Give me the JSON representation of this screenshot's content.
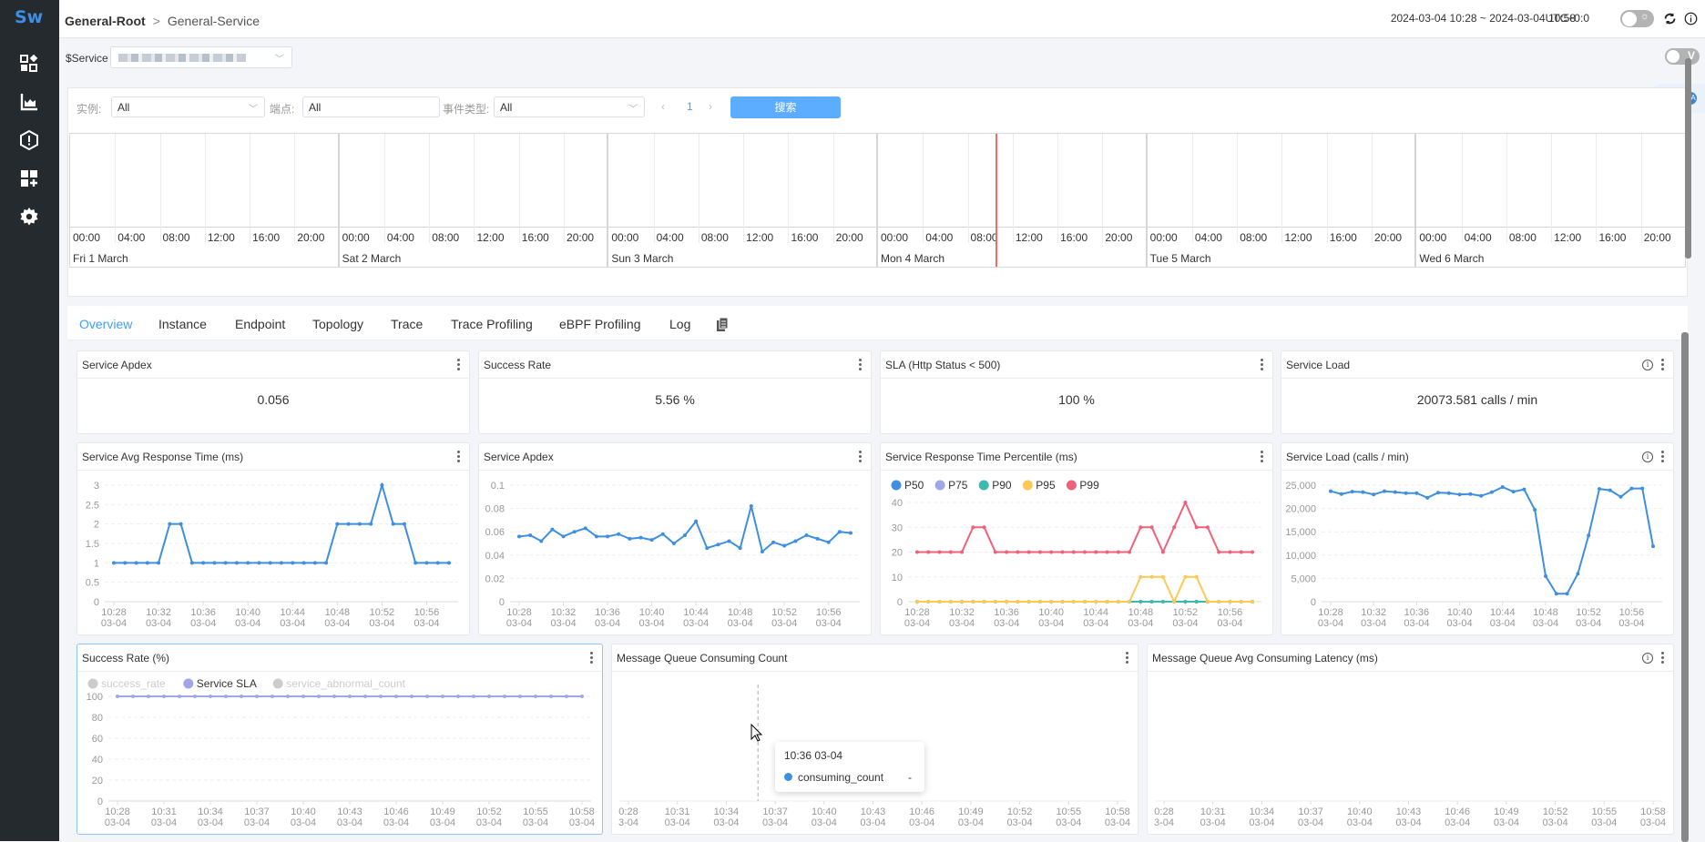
{
  "app": {
    "logo": "Sw"
  },
  "sidebar": {
    "items": [
      {
        "icon": "dashboard-icon"
      },
      {
        "icon": "metrics-chart-icon"
      },
      {
        "icon": "alert-icon"
      },
      {
        "icon": "add-widget-icon"
      },
      {
        "icon": "settings-icon"
      }
    ]
  },
  "header": {
    "breadcrumb": {
      "root": "General-Root",
      "current": "General-Service"
    },
    "time_range": "2024-03-04 10:28 ~ 2024-03-04 10:58",
    "timezone": "UTC+0:0",
    "theme_toggle": "off",
    "icons": [
      "refresh-icon",
      "info-icon"
    ]
  },
  "service_bar": {
    "label": "$Service",
    "value": "(blurred)",
    "v_toggle_label": "V"
  },
  "filters": {
    "instance_label": "实例:",
    "instance_value": "All",
    "endpoint_label": "端点:",
    "endpoint_value": "All",
    "event_type_label": "事件类型:",
    "event_type_value": "All",
    "page": "1",
    "search_button": "搜索"
  },
  "timeline": {
    "hours": [
      "00:00",
      "04:00",
      "08:00",
      "12:00",
      "16:00",
      "20:00"
    ],
    "days": [
      "Fri 1 March",
      "Sat 2 March",
      "Sun 3 March",
      "Mon 4 March",
      "Tue 5 March",
      "Wed 6 March"
    ],
    "now_marker": "Mon 4 March ~10:28",
    "now_color": "#f06c6c"
  },
  "tabs": [
    "Overview",
    "Instance",
    "Endpoint",
    "Topology",
    "Trace",
    "Trace Profiling",
    "eBPF Profiling",
    "Log"
  ],
  "active_tab": "Overview",
  "cards": {
    "apdex_value": {
      "title": "Service Apdex",
      "value": "0.056"
    },
    "success_rate": {
      "title": "Success Rate",
      "value": "5.56 %"
    },
    "sla": {
      "title": "SLA (Http Status < 500)",
      "value": "100 %"
    },
    "load": {
      "title": "Service Load",
      "value": "20073.581 calls / min"
    }
  },
  "tooltip": {
    "title": "10:36 03-04",
    "series": "consuming_count",
    "value": "-"
  },
  "chart_data": [
    {
      "type": "line",
      "title": "Service Avg Response Time (ms)",
      "x_ticks": [
        "10:28",
        "10:32",
        "10:36",
        "10:40",
        "10:44",
        "10:48",
        "10:52",
        "10:56"
      ],
      "x_sub": "03-04",
      "ylim": [
        0,
        3
      ],
      "y_ticks": [
        "0",
        "0.5",
        "1",
        "1.5",
        "2",
        "2.5",
        "3"
      ],
      "series": [
        {
          "name": "resp_time",
          "color": "#3f8fe0",
          "values": [
            1,
            1,
            1,
            1,
            1,
            2,
            2,
            1,
            1,
            1,
            1,
            1,
            1,
            1,
            1,
            1,
            1,
            1,
            1,
            1,
            2,
            2,
            2,
            2,
            3,
            2,
            2,
            1,
            1,
            1,
            1
          ]
        }
      ]
    },
    {
      "type": "line",
      "title": "Service Apdex",
      "x_ticks": [
        "10:28",
        "10:32",
        "10:36",
        "10:40",
        "10:44",
        "10:48",
        "10:52",
        "10:56"
      ],
      "x_sub": "03-04",
      "ylim": [
        0,
        0.1
      ],
      "y_ticks": [
        "0",
        "0.02",
        "0.04",
        "0.06",
        "0.08",
        "0.1"
      ],
      "series": [
        {
          "name": "apdex",
          "color": "#3f8fe0",
          "values": [
            0.056,
            0.057,
            0.052,
            0.062,
            0.056,
            0.06,
            0.063,
            0.056,
            0.056,
            0.058,
            0.054,
            0.055,
            0.053,
            0.058,
            0.05,
            0.057,
            0.069,
            0.046,
            0.049,
            0.052,
            0.046,
            0.082,
            0.043,
            0.051,
            0.048,
            0.052,
            0.057,
            0.054,
            0.051,
            0.06,
            0.059
          ]
        }
      ]
    },
    {
      "type": "line",
      "title": "Service Response Time Percentile (ms)",
      "x_ticks": [
        "10:28",
        "10:32",
        "10:36",
        "10:40",
        "10:44",
        "10:48",
        "10:52",
        "10:56"
      ],
      "x_sub": "03-04",
      "ylim": [
        0,
        40
      ],
      "y_ticks": [
        "0",
        "10",
        "20",
        "30",
        "40"
      ],
      "legend": [
        "P50",
        "P75",
        "P90",
        "P95",
        "P99"
      ],
      "legend_position": "top-left",
      "series": [
        {
          "name": "P50",
          "color": "#3f8fe0",
          "values": [
            0,
            0,
            0,
            0,
            0,
            0,
            0,
            0,
            0,
            0,
            0,
            0,
            0,
            0,
            0,
            0,
            0,
            0,
            0,
            0,
            0,
            0,
            0,
            0,
            0,
            0,
            0,
            0,
            0,
            0,
            0
          ]
        },
        {
          "name": "P75",
          "color": "#a0a7e6",
          "values": [
            0,
            0,
            0,
            0,
            0,
            0,
            0,
            0,
            0,
            0,
            0,
            0,
            0,
            0,
            0,
            0,
            0,
            0,
            0,
            0,
            0,
            0,
            0,
            0,
            0,
            0,
            0,
            0,
            0,
            0,
            0
          ]
        },
        {
          "name": "P90",
          "color": "#3cbab2",
          "values": [
            0,
            0,
            0,
            0,
            0,
            0,
            0,
            0,
            0,
            0,
            0,
            0,
            0,
            0,
            0,
            0,
            0,
            0,
            0,
            0,
            0,
            0,
            0,
            0,
            0,
            0,
            0,
            0,
            0,
            0,
            0
          ]
        },
        {
          "name": "P95",
          "color": "#fcc955",
          "values": [
            0,
            0,
            0,
            0,
            0,
            0,
            0,
            0,
            0,
            0,
            0,
            0,
            0,
            0,
            0,
            0,
            0,
            0,
            0,
            0,
            10,
            10,
            10,
            0,
            10,
            10,
            0,
            0,
            0,
            0,
            0
          ]
        },
        {
          "name": "P99",
          "color": "#f1607a",
          "values": [
            20,
            20,
            20,
            20,
            20,
            30,
            30,
            20,
            20,
            20,
            20,
            20,
            20,
            20,
            20,
            20,
            20,
            20,
            20,
            20,
            30,
            30,
            20,
            30,
            40,
            30,
            30,
            20,
            20,
            20,
            20
          ]
        }
      ]
    },
    {
      "type": "line",
      "title": "Service Load (calls / min)",
      "x_ticks": [
        "10:28",
        "10:32",
        "10:36",
        "10:40",
        "10:44",
        "10:48",
        "10:52",
        "10:56"
      ],
      "x_sub": "03-04",
      "ylim": [
        0,
        25000
      ],
      "y_ticks": [
        "0",
        "5,000",
        "10,000",
        "15,000",
        "20,000",
        "25,000"
      ],
      "series": [
        {
          "name": "load",
          "color": "#3f8fe0",
          "values": [
            23700,
            23100,
            23600,
            23500,
            23000,
            23700,
            23500,
            23300,
            23300,
            22300,
            23400,
            23300,
            23000,
            23100,
            22700,
            23500,
            24600,
            23600,
            24100,
            19700,
            5500,
            1700,
            1700,
            6000,
            14200,
            24200,
            23900,
            22500,
            24300,
            24300,
            11900
          ]
        }
      ]
    },
    {
      "type": "line",
      "title": "Success Rate (%)",
      "x_ticks": [
        "10:28",
        "10:31",
        "10:34",
        "10:37",
        "10:40",
        "10:43",
        "10:46",
        "10:49",
        "10:52",
        "10:55",
        "10:58"
      ],
      "x_sub": "03-04",
      "ylim": [
        0,
        100
      ],
      "y_ticks": [
        "0",
        "20",
        "40",
        "60",
        "80",
        "100"
      ],
      "legend": [
        "success_rate",
        "Service SLA",
        "service_abnormal_count"
      ],
      "legend_position": "top-left",
      "legend_disabled": [
        "success_rate",
        "service_abnormal_count"
      ],
      "series": [
        {
          "name": "Service SLA",
          "color": "#a0a7e6",
          "values": [
            100,
            100,
            100,
            100,
            100,
            100,
            100,
            100,
            100,
            100,
            100,
            100,
            100,
            100,
            100,
            100,
            100,
            100,
            100,
            100,
            100,
            100,
            100,
            100,
            100,
            100,
            100,
            100,
            100,
            100,
            100
          ]
        }
      ]
    },
    {
      "type": "line",
      "title": "Message Queue Consuming Count",
      "x_ticks": [
        "0:28",
        "10:31",
        "10:34",
        "10:37",
        "10:40",
        "10:43",
        "10:46",
        "10:49",
        "10:52",
        "10:55",
        "10:58"
      ],
      "x_sub": [
        "3-04",
        "03-04",
        "03-04",
        "03-04",
        "03-04",
        "03-04",
        "03-04",
        "03-04",
        "03-04",
        "03-04",
        "03-04"
      ],
      "series": [
        {
          "name": "consuming_count",
          "color": "#3f8fe0",
          "values": []
        }
      ]
    },
    {
      "type": "line",
      "title": "Message Queue Avg Consuming Latency (ms)",
      "x_ticks": [
        "0:28",
        "10:31",
        "10:34",
        "10:37",
        "10:40",
        "10:43",
        "10:46",
        "10:49",
        "10:52",
        "10:55",
        "10:58"
      ],
      "x_sub": [
        "3-04",
        "03-04",
        "03-04",
        "03-04",
        "03-04",
        "03-04",
        "03-04",
        "03-04",
        "03-04",
        "03-04",
        "03-04"
      ],
      "series": []
    }
  ]
}
